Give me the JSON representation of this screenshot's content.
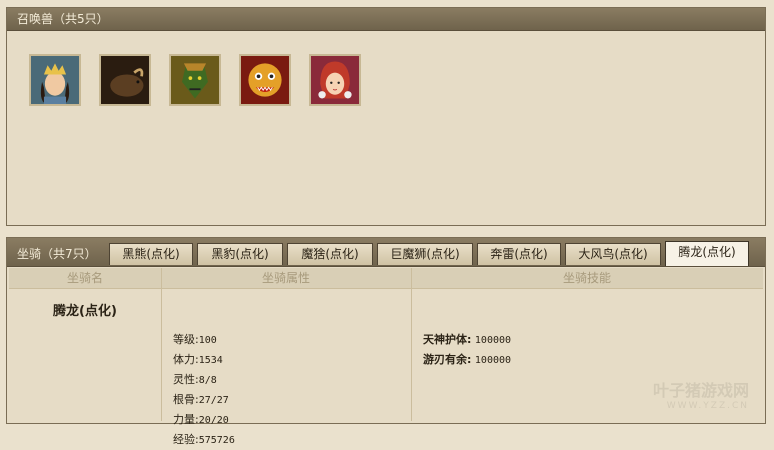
{
  "summon": {
    "title": "召唤兽（共5只）",
    "pets": [
      {
        "icon": "crowned-woman-portrait"
      },
      {
        "icon": "ox-portrait"
      },
      {
        "icon": "green-ogre-portrait"
      },
      {
        "icon": "lion-dance-portrait"
      },
      {
        "icon": "pink-hair-girl-portrait"
      }
    ]
  },
  "mounts": {
    "count_label": "坐骑（共7只）",
    "tabs": [
      "黑熊(点化)",
      "黑豹(点化)",
      "魔猞(点化)",
      "巨魔狮(点化)",
      "奔雷(点化)",
      "大风鸟(点化)",
      "腾龙(点化)"
    ],
    "active_tab": 6,
    "columns": {
      "name": "坐骑名",
      "attributes": "坐骑属性",
      "skills": "坐骑技能"
    },
    "selected": {
      "name": "腾龙(点化)",
      "attributes": [
        {
          "label": "等级:",
          "value": "100"
        },
        {
          "label": "体力:",
          "value": "1534"
        },
        {
          "label": "灵性:",
          "value": "8/8"
        },
        {
          "label": "根骨:",
          "value": "27/27"
        },
        {
          "label": "力量:",
          "value": "20/20"
        },
        {
          "label": "经验:",
          "value": "575726"
        }
      ],
      "skills": [
        {
          "label": "天神护体:",
          "value": "100000"
        },
        {
          "label": "游刃有余:",
          "value": "100000"
        }
      ]
    }
  },
  "watermark": {
    "title": "叶子猪游戏网",
    "url": "WWW.YZZ.CN"
  }
}
